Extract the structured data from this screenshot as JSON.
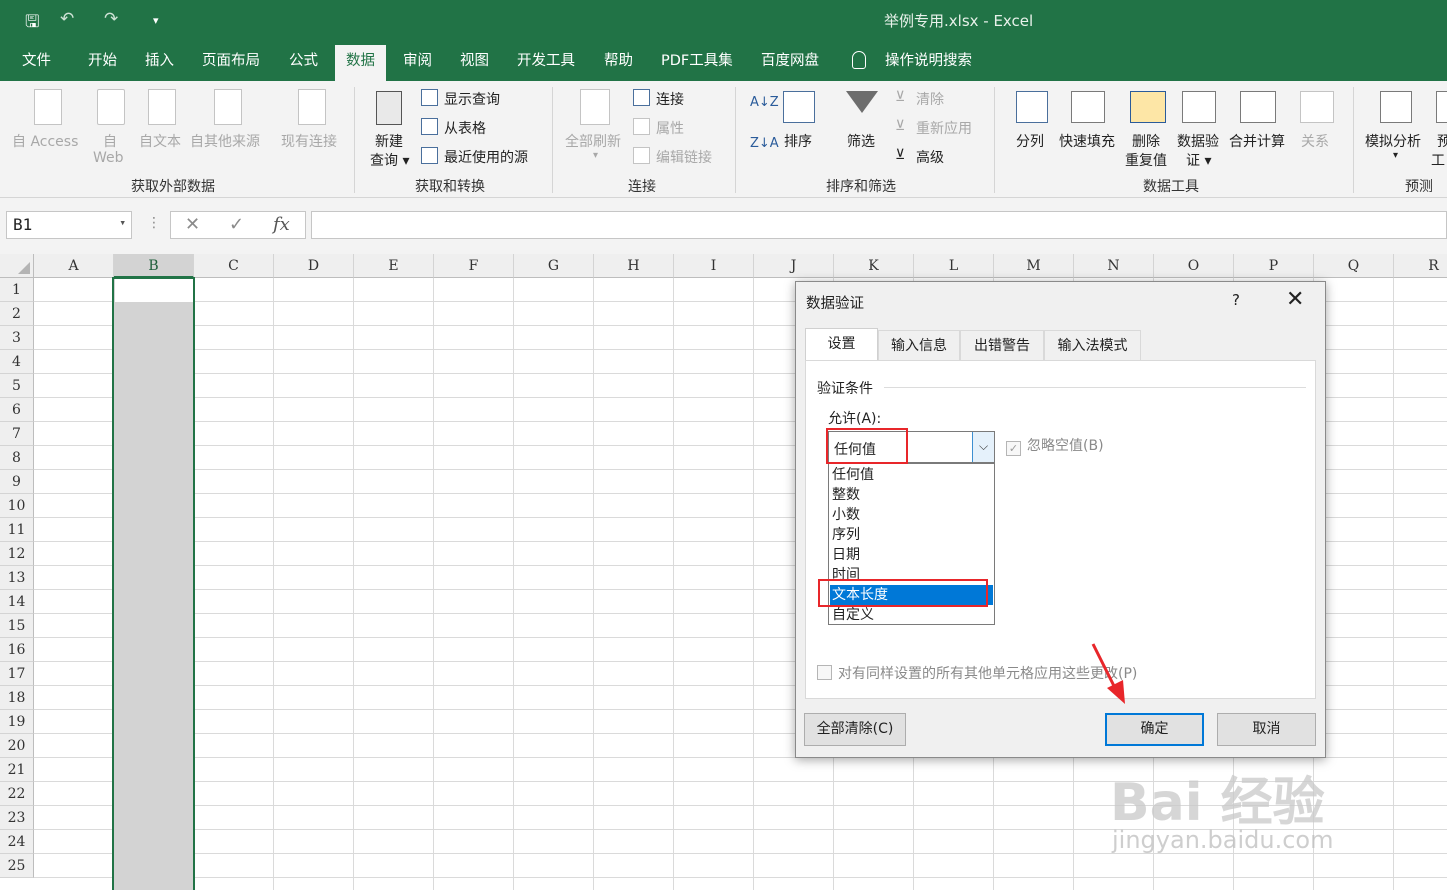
{
  "window": {
    "title": "举例专用.xlsx  -  Excel"
  },
  "quick_access": {
    "save": "🖫",
    "undo": "↶",
    "redo": "↷",
    "customize": "▾"
  },
  "tabs": [
    "文件",
    "开始",
    "插入",
    "页面布局",
    "公式",
    "数据",
    "审阅",
    "视图",
    "开发工具",
    "帮助",
    "PDF工具集",
    "百度网盘"
  ],
  "tell_me": "操作说明搜索",
  "ribbon": {
    "get_external": {
      "access": "自 Access",
      "web1": "自",
      "web2": "Web",
      "text": "自文本",
      "other": "自其他来源",
      "existing": "现有连接",
      "group": "获取外部数据"
    },
    "transform": {
      "new_query1": "新建",
      "new_query2": "查询 ▾",
      "show_queries": "显示查询",
      "from_table": "从表格",
      "recent_sources": "最近使用的源",
      "group": "获取和转换"
    },
    "connections": {
      "refresh_all": "全部刷新",
      "connections": "连接",
      "properties": "属性",
      "edit_links": "编辑链接",
      "group": "连接"
    },
    "sort_filter": {
      "sort": "排序",
      "filter": "筛选",
      "clear": "清除",
      "reapply": "重新应用",
      "advanced": "高级",
      "group": "排序和筛选"
    },
    "data_tools": {
      "split": "分列",
      "flash_fill": "快速填充",
      "remove_dup1": "删除",
      "remove_dup2": "重复值",
      "validation1": "数据验",
      "validation2": "证 ▾",
      "consolidate": "合并计算",
      "relations": "关系",
      "group": "数据工具"
    },
    "forecast": {
      "what_if": "模拟分析",
      "forecast_sheet1": "预",
      "forecast_sheet2": "工",
      "group": "预测"
    }
  },
  "formula_bar": {
    "name_box": "B1",
    "cancel": "✕",
    "enter": "✓",
    "fx": "fx",
    "formula": ""
  },
  "columns": [
    "A",
    "B",
    "C",
    "D",
    "E",
    "F",
    "G",
    "H",
    "I",
    "J",
    "K",
    "L",
    "M",
    "N",
    "O",
    "P",
    "Q",
    "R"
  ],
  "rows": [
    "1",
    "2",
    "3",
    "4",
    "5",
    "6",
    "7",
    "8",
    "9",
    "10",
    "11",
    "12",
    "13",
    "14",
    "15",
    "16",
    "17",
    "18",
    "19",
    "20",
    "21",
    "22",
    "23",
    "24",
    "25"
  ],
  "dialog": {
    "title": "数据验证",
    "help": "?",
    "close": "✕",
    "tabs": [
      "设置",
      "输入信息",
      "出错警告",
      "输入法模式"
    ],
    "section": "验证条件",
    "allow_label": "允许(A):",
    "allow_value": "任何值",
    "options": [
      "任何值",
      "整数",
      "小数",
      "序列",
      "日期",
      "时间",
      "文本长度",
      "自定义"
    ],
    "highlighted": "文本长度",
    "ignore_blank": "忽略空值(B)",
    "apply_all": "对有同样设置的所有其他单元格应用这些更改(P)",
    "clear_all": "全部清除(C)",
    "ok": "确定",
    "cancel": "取消"
  },
  "watermark": {
    "main": "Bai 经验",
    "sub": "jingyan.baidu.com"
  }
}
